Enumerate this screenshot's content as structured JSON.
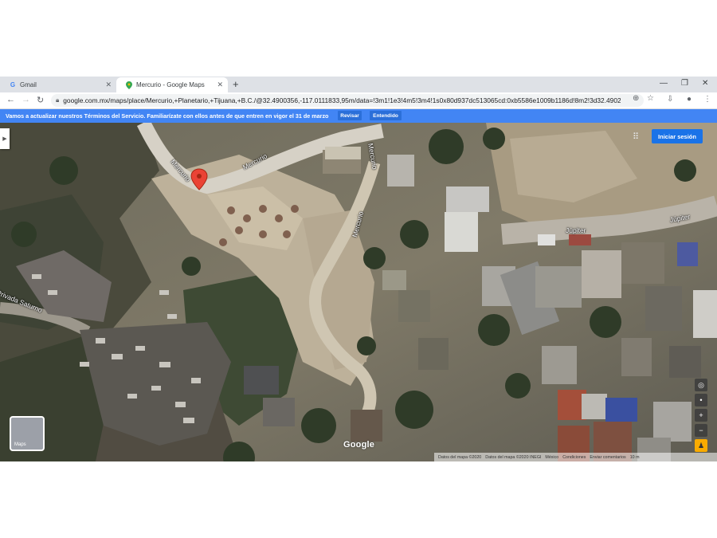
{
  "browser": {
    "tabs": [
      {
        "title": "Gmail",
        "icon": "gmail-g-icon",
        "active": false
      },
      {
        "title": "Mercurio - Google Maps",
        "icon": "maps-pin-icon",
        "active": true
      }
    ],
    "url": "google.com.mx/maps/place/Mercurio,+Planetario,+Tijuana,+B.C./@32.4900356,-117.0111833,95m/data=!3m1!1e3!4m5!3m4!1s0x80d937dc513065cd:0xb5586e1009b1186d!8m2!3d32.4902924!..."
  },
  "banner": {
    "text": "Vamos a actualizar nuestros Términos del Servicio. Familiarízate con ellos antes de que entren en vigor el 31 de marzo",
    "review_label": "Revisar",
    "ok_label": "Entendido"
  },
  "map": {
    "signin_label": "Iniciar sesión",
    "layers_label": "Maps",
    "logo_text": "Google",
    "streets": {
      "mercurio_1": "Mercurio",
      "mercurio_2": "Mercurio",
      "mercurio_3": "Mercurio",
      "mercurio_4": "Mercurio",
      "jupiter_1": "Júpiter",
      "jupiter_2": "Júpiter",
      "saturno": "Privada Saturno"
    },
    "attribution": [
      "Datos del mapa ©2020",
      "Datos del mapa ©2020 INEGI",
      "México",
      "Condiciones",
      "Enviar comentarios",
      "10 m"
    ],
    "marker_color": "#ea4335"
  }
}
